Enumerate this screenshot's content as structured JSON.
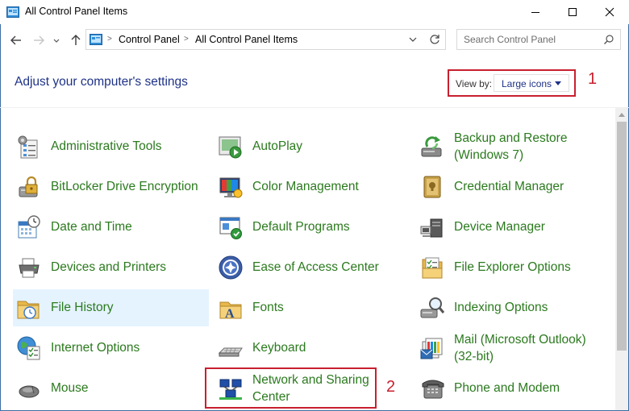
{
  "window": {
    "title": "All Control Panel Items"
  },
  "address_bar": {
    "crumbs": [
      "Control Panel",
      "All Control Panel Items"
    ]
  },
  "search": {
    "placeholder": "Search Control Panel"
  },
  "header": {
    "title": "Adjust your computer's settings",
    "view_by_label": "View by:",
    "view_by_value": "Large icons"
  },
  "annotations": {
    "one": "1",
    "two": "2"
  },
  "items": [
    {
      "label": "Administrative Tools",
      "icon": "administrative-tools-icon"
    },
    {
      "label": "AutoPlay",
      "icon": "autoplay-icon"
    },
    {
      "label": "Backup and Restore (Windows 7)",
      "line1": "Backup and Restore",
      "line2": "(Windows 7)",
      "icon": "backup-restore-icon"
    },
    {
      "label": "BitLocker Drive Encryption",
      "icon": "bitlocker-icon"
    },
    {
      "label": "Color Management",
      "icon": "color-management-icon"
    },
    {
      "label": "Credential Manager",
      "icon": "credential-manager-icon"
    },
    {
      "label": "Date and Time",
      "icon": "calendar-clock-icon"
    },
    {
      "label": "Default Programs",
      "icon": "default-programs-icon"
    },
    {
      "label": "Device Manager",
      "icon": "device-manager-icon"
    },
    {
      "label": "Devices and Printers",
      "icon": "printer-icon"
    },
    {
      "label": "Ease of Access Center",
      "icon": "ease-of-access-icon"
    },
    {
      "label": "File Explorer Options",
      "icon": "folder-options-icon"
    },
    {
      "label": "File History",
      "icon": "file-history-icon"
    },
    {
      "label": "Fonts",
      "icon": "fonts-icon"
    },
    {
      "label": "Indexing Options",
      "icon": "indexing-options-icon"
    },
    {
      "label": "Internet Options",
      "icon": "internet-options-icon"
    },
    {
      "label": "Keyboard",
      "icon": "keyboard-icon"
    },
    {
      "label": "Mail (Microsoft Outlook) (32-bit)",
      "line1": "Mail (Microsoft Outlook)",
      "line2": "(32-bit)",
      "icon": "mail-icon"
    },
    {
      "label": "Mouse",
      "icon": "mouse-icon"
    },
    {
      "label": "Network and Sharing Center",
      "line1": "Network and Sharing",
      "line2": "Center",
      "icon": "network-icon"
    },
    {
      "label": "Phone and Modem",
      "icon": "phone-modem-icon"
    }
  ],
  "colors": {
    "link_green": "#2b7a1e",
    "heading_blue": "#1e3287",
    "annotation_red": "#c8202f",
    "hover_bg": "#e5f3ff"
  }
}
